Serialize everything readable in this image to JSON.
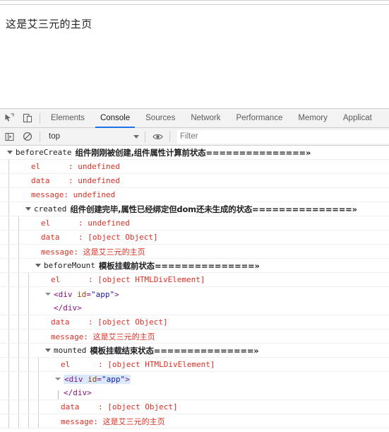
{
  "page": {
    "heading": "这是艾三元的主页"
  },
  "devtools": {
    "inspect_icon": "inspect-cursor-icon",
    "device_icon": "device-toolbar-icon",
    "tabs": [
      {
        "label": "Elements",
        "active": false
      },
      {
        "label": "Console",
        "active": true
      },
      {
        "label": "Sources",
        "active": false
      },
      {
        "label": "Network",
        "active": false
      },
      {
        "label": "Performance",
        "active": false
      },
      {
        "label": "Memory",
        "active": false
      },
      {
        "label": "Applicat",
        "active": false
      }
    ],
    "toolbar": {
      "sidebar_icon": "console-sidebar-icon",
      "clear_icon": "clear-console-icon",
      "context_value": "top",
      "eye_icon": "live-expression-eye-icon",
      "filter_placeholder": "Filter"
    },
    "accent_color": "#1a73e8",
    "error_color": "#d93025",
    "console": {
      "groups": [
        {
          "name": "beforeCreate",
          "description": "组件刚刚被创建,组件属性计算前状态===============»",
          "depth": 0,
          "rows": [
            {
              "type": "error",
              "text": "el      : undefined"
            },
            {
              "type": "error",
              "text": "data    : undefined"
            },
            {
              "type": "error",
              "text": "message: undefined"
            }
          ]
        },
        {
          "name": "created",
          "description": "组件创建完毕,属性已经绑定但dom还未生成的状态===============»",
          "depth": 1,
          "rows": [
            {
              "type": "error",
              "text": "el      : undefined"
            },
            {
              "type": "error",
              "text": "data    : [object Object]"
            },
            {
              "type": "error_cjk",
              "text": "message: 这是艾三元的主页"
            }
          ]
        },
        {
          "name": "beforeMount",
          "description": "模板挂载前状态===============»",
          "depth": 2,
          "rows": [
            {
              "type": "error",
              "text": "el      : [object HTMLDivElement]"
            },
            {
              "type": "dom",
              "open_tag": "<div id=\"app\">",
              "tag": "div",
              "attr_name": "id",
              "attr_value": "\"app\"",
              "close_tag": "</div>",
              "highlighted": false
            },
            {
              "type": "error",
              "text": "data    : [object Object]"
            },
            {
              "type": "error_cjk",
              "text": "message: 这是艾三元的主页"
            }
          ]
        },
        {
          "name": "mounted",
          "description": "模板挂载结束状态===============»",
          "depth": 3,
          "rows": [
            {
              "type": "error",
              "text": "el      : [object HTMLDivElement]"
            },
            {
              "type": "dom",
              "open_tag": "<div id=\"app\">",
              "tag": "div",
              "attr_name": "id",
              "attr_value": "\"app\"",
              "close_tag": "</div>",
              "highlighted": true
            },
            {
              "type": "error",
              "text": "data    : [object Object]"
            },
            {
              "type": "error_cjk",
              "text": "message: 这是艾三元的主页"
            }
          ]
        }
      ]
    }
  }
}
